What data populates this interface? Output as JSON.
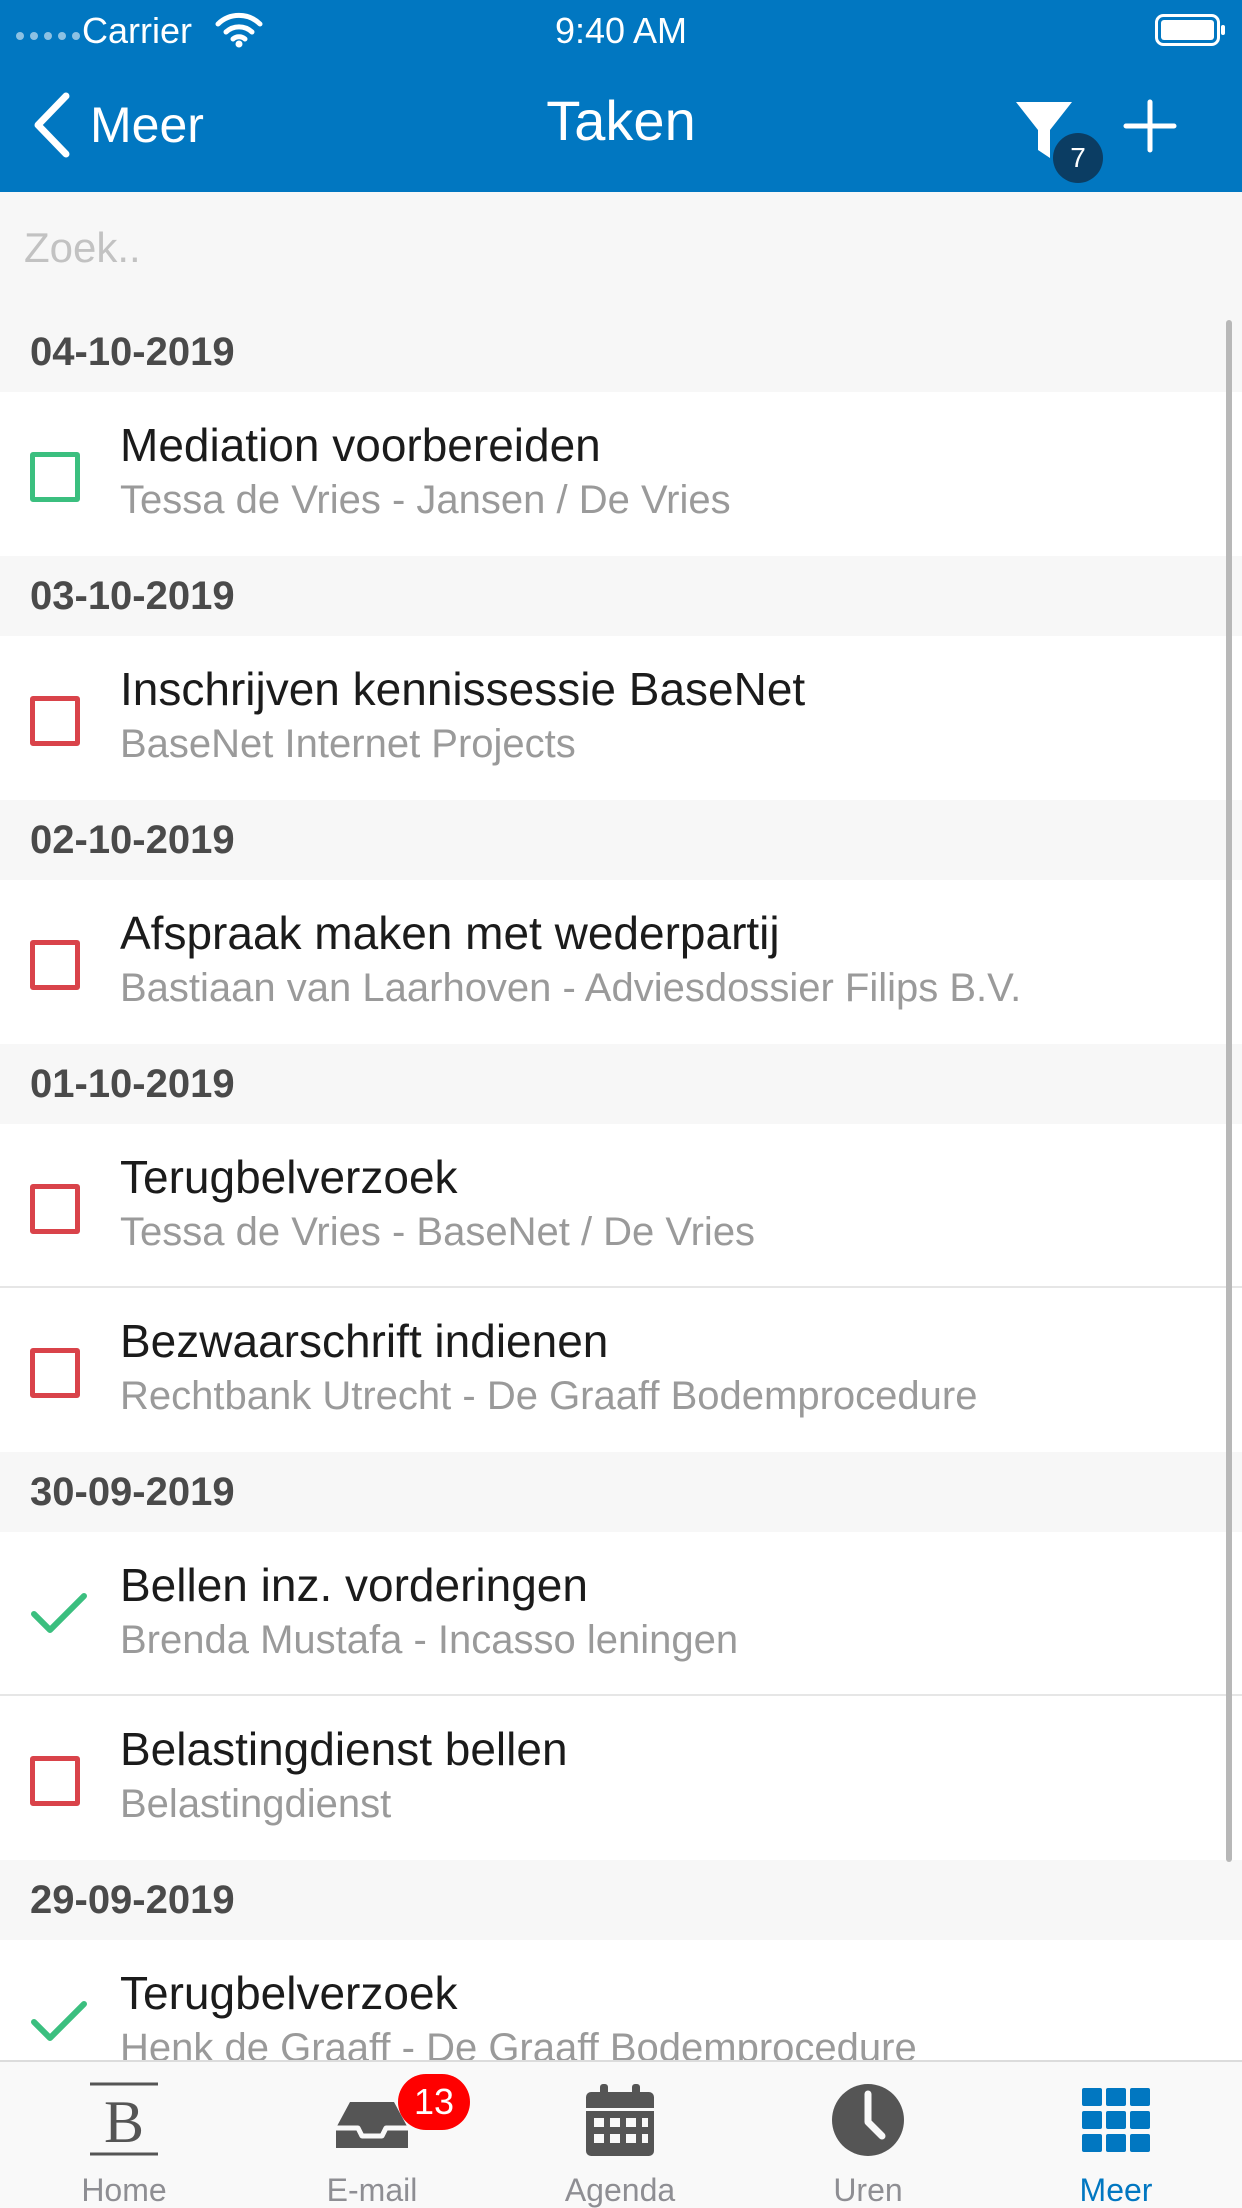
{
  "status_bar": {
    "carrier": "Carrier",
    "time": "9:40 AM"
  },
  "nav": {
    "back_label": "Meer",
    "title": "Taken",
    "filter_count": "7"
  },
  "search": {
    "placeholder": "Zoek.."
  },
  "sections": [
    {
      "date": "04-10-2019",
      "tasks": [
        {
          "title": "Mediation voorbereiden",
          "subtitle": "Tessa de Vries - Jansen / De Vries",
          "state": "open-green"
        }
      ]
    },
    {
      "date": "03-10-2019",
      "tasks": [
        {
          "title": "Inschrijven kennissessie BaseNet",
          "subtitle": "BaseNet Internet Projects",
          "state": "open-red"
        }
      ]
    },
    {
      "date": "02-10-2019",
      "tasks": [
        {
          "title": "Afspraak maken met wederpartij",
          "subtitle": "Bastiaan van Laarhoven - Adviesdossier Filips B.V.",
          "state": "open-red"
        }
      ]
    },
    {
      "date": "01-10-2019",
      "tasks": [
        {
          "title": "Terugbelverzoek",
          "subtitle": "Tessa de Vries - BaseNet / De Vries",
          "state": "open-red"
        },
        {
          "title": "Bezwaarschrift indienen",
          "subtitle": "Rechtbank Utrecht - De Graaff Bodemprocedure",
          "state": "open-red"
        }
      ]
    },
    {
      "date": "30-09-2019",
      "tasks": [
        {
          "title": "Bellen inz. vorderingen",
          "subtitle": "Brenda Mustafa - Incasso leningen",
          "state": "done"
        },
        {
          "title": "Belastingdienst bellen",
          "subtitle": "Belastingdienst",
          "state": "open-red"
        }
      ]
    },
    {
      "date": "29-09-2019",
      "tasks": [
        {
          "title": "Terugbelverzoek",
          "subtitle": "Henk de Graaff - De Graaff Bodemprocedure",
          "state": "done"
        }
      ]
    }
  ],
  "tabs": [
    {
      "label": "Home",
      "icon": "basenet-logo-icon"
    },
    {
      "label": "E-mail",
      "icon": "inbox-icon",
      "badge": "13"
    },
    {
      "label": "Agenda",
      "icon": "calendar-icon"
    },
    {
      "label": "Uren",
      "icon": "clock-icon"
    },
    {
      "label": "Meer",
      "icon": "grid-icon",
      "active": true
    }
  ],
  "colors": {
    "header_blue": "#0177c1",
    "badge_dark": "#0b3d63",
    "checkbox_red": "#d9434a",
    "checkbox_green": "#3bbf7f",
    "tab_active": "#0177c1",
    "tab_inactive": "#8e8e93",
    "badge_red": "#ff0000"
  }
}
